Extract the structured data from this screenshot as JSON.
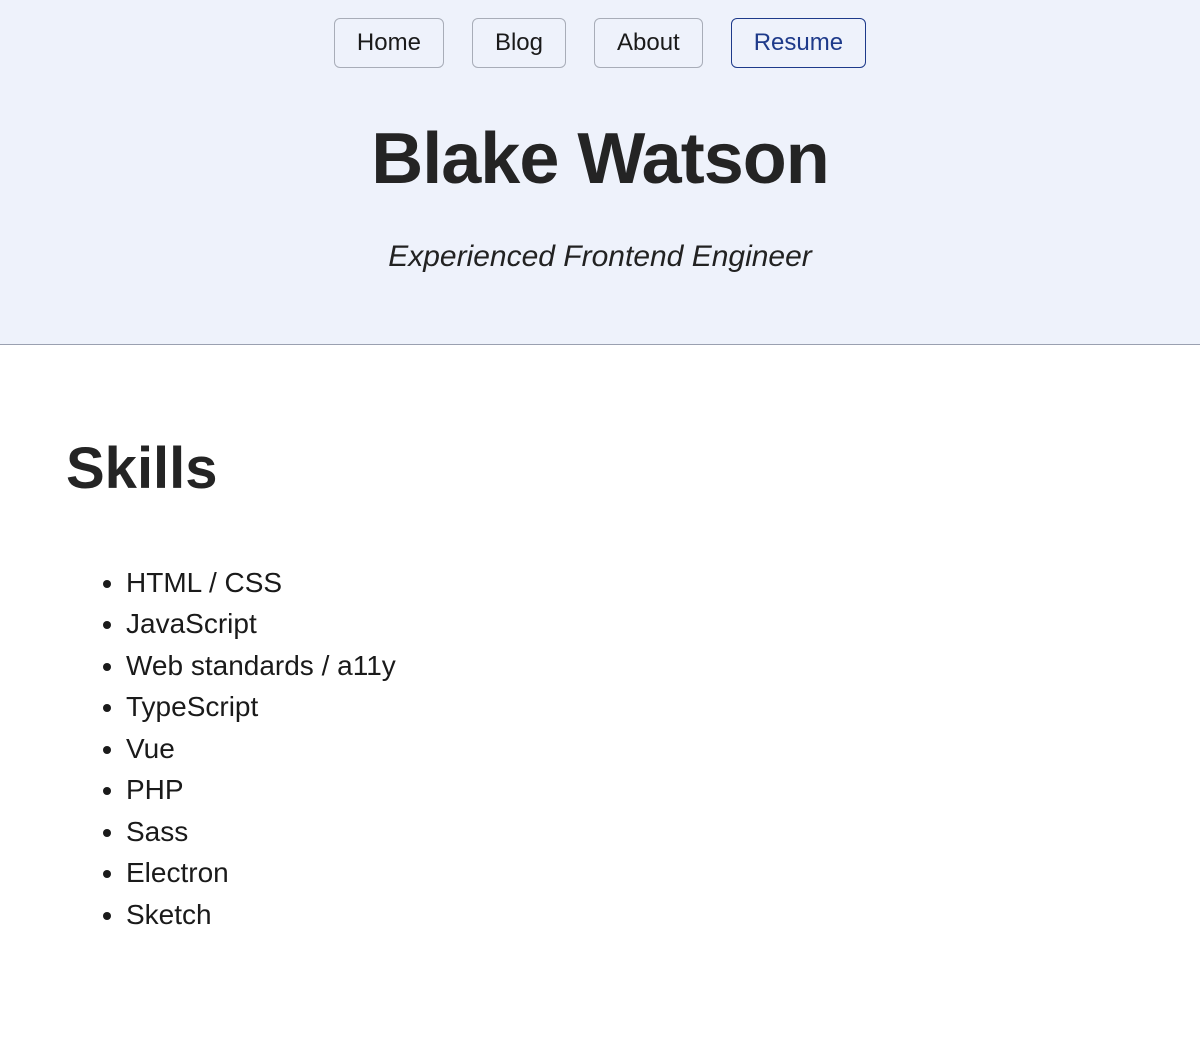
{
  "nav": {
    "items": [
      {
        "label": "Home",
        "active": false
      },
      {
        "label": "Blog",
        "active": false
      },
      {
        "label": "About",
        "active": false
      },
      {
        "label": "Resume",
        "active": true
      }
    ]
  },
  "header": {
    "title": "Blake Watson",
    "subtitle": "Experienced Frontend Engineer"
  },
  "sections": {
    "skills": {
      "heading": "Skills",
      "items": [
        "HTML / CSS",
        "JavaScript",
        "Web standards / a11y",
        "TypeScript",
        "Vue",
        "PHP",
        "Sass",
        "Electron",
        "Sketch"
      ]
    }
  }
}
